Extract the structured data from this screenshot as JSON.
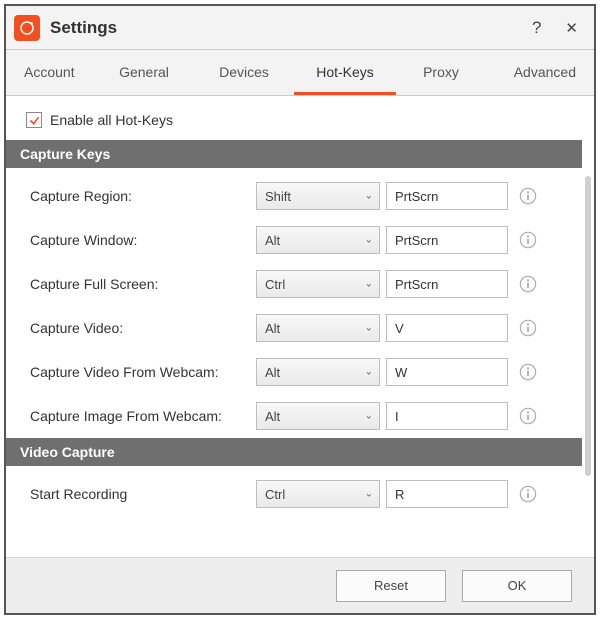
{
  "window": {
    "title": "Settings"
  },
  "titlebar": {
    "help_label": "?",
    "close_label": "✕"
  },
  "tabs": {
    "account": "Account",
    "general": "General",
    "devices": "Devices",
    "hotkeys": "Hot-Keys",
    "proxy": "Proxy",
    "advanced": "Advanced",
    "active": "hotkeys"
  },
  "enable_all": {
    "label": "Enable all Hot-Keys",
    "checked": true
  },
  "sections": {
    "capture_keys": {
      "title": "Capture Keys",
      "rows": [
        {
          "label": "Capture Region:",
          "modifier": "Shift",
          "key": "PrtScrn"
        },
        {
          "label": "Capture Window:",
          "modifier": "Alt",
          "key": "PrtScrn"
        },
        {
          "label": "Capture Full Screen:",
          "modifier": "Ctrl",
          "key": "PrtScrn"
        },
        {
          "label": "Capture Video:",
          "modifier": "Alt",
          "key": "V"
        },
        {
          "label": "Capture Video From Webcam:",
          "modifier": "Alt",
          "key": "W"
        },
        {
          "label": "Capture Image From Webcam:",
          "modifier": "Alt",
          "key": "I"
        }
      ]
    },
    "video_capture": {
      "title": "Video Capture",
      "rows": [
        {
          "label": "Start Recording",
          "modifier": "Ctrl",
          "key": "R"
        }
      ]
    }
  },
  "footer": {
    "reset": "Reset",
    "ok": "OK"
  },
  "colors": {
    "accent": "#f25022",
    "section_header": "#6f6f6f"
  }
}
